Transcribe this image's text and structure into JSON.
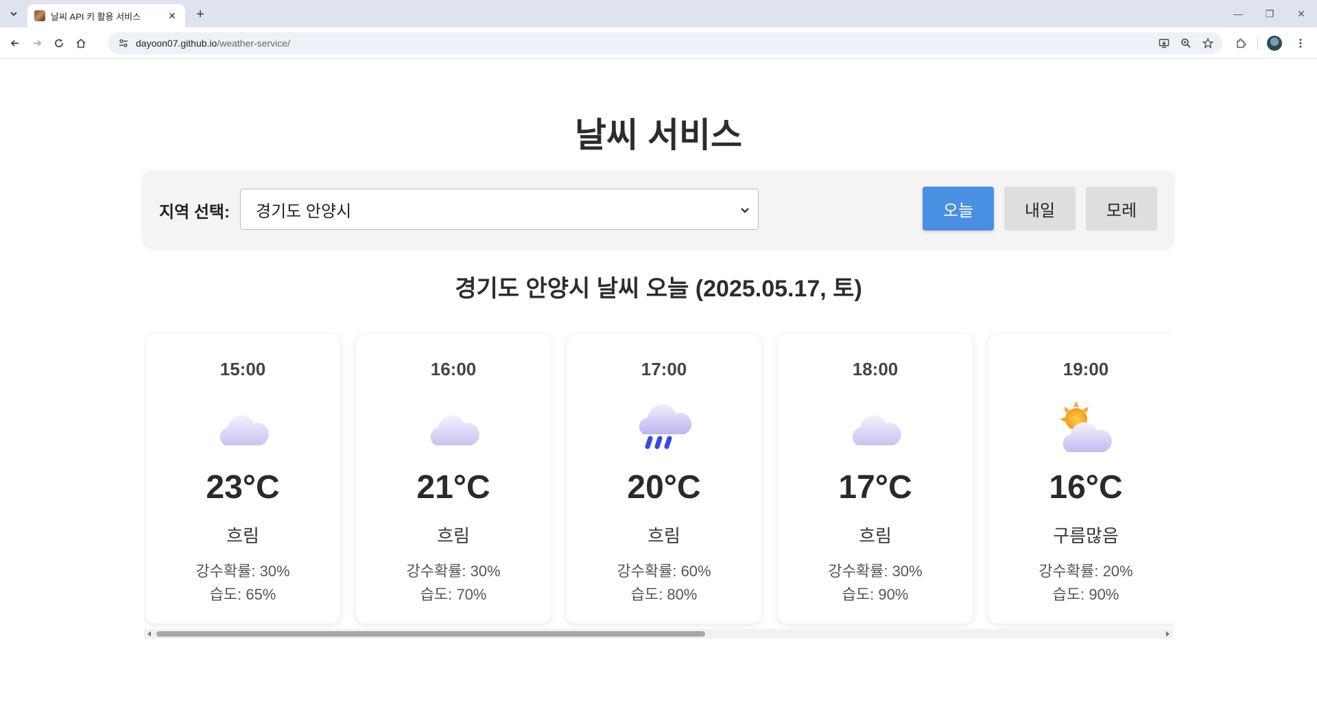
{
  "browser": {
    "tab_title": "날씨 API 키 활용 서비스",
    "url_host": "dayoon07.github.io",
    "url_path": "/weather-service/"
  },
  "page": {
    "title": "날씨 서비스",
    "region_label": "지역 선택:",
    "region_selected": "경기도 안양시",
    "day_buttons": [
      {
        "label": "오늘",
        "active": true
      },
      {
        "label": "내일",
        "active": false
      },
      {
        "label": "모레",
        "active": false
      }
    ],
    "forecast_heading": "경기도 안양시 날씨 오늘 (2025.05.17, 토)"
  },
  "forecast": [
    {
      "time": "15:00",
      "icon": "cloud-icon",
      "temp": "23°C",
      "condition": "흐림",
      "precip": "강수확률: 30%",
      "humidity": "습도: 65%"
    },
    {
      "time": "16:00",
      "icon": "cloud-icon",
      "temp": "21°C",
      "condition": "흐림",
      "precip": "강수확률: 30%",
      "humidity": "습도: 70%"
    },
    {
      "time": "17:00",
      "icon": "rain-cloud-icon",
      "temp": "20°C",
      "condition": "흐림",
      "precip": "강수확률: 60%",
      "humidity": "습도: 80%"
    },
    {
      "time": "18:00",
      "icon": "cloud-icon",
      "temp": "17°C",
      "condition": "흐림",
      "precip": "강수확률: 30%",
      "humidity": "습도: 90%"
    },
    {
      "time": "19:00",
      "icon": "sun-behind-cloud-icon",
      "temp": "16°C",
      "condition": "구름많음",
      "precip": "강수확률: 20%",
      "humidity": "습도: 90%"
    }
  ],
  "colors": {
    "accent": "#4a90e2",
    "inactive_button": "#dedede",
    "panel_bg": "#f4f4f4"
  },
  "scroll": {
    "horizontal_visible_fraction": 0.53
  }
}
